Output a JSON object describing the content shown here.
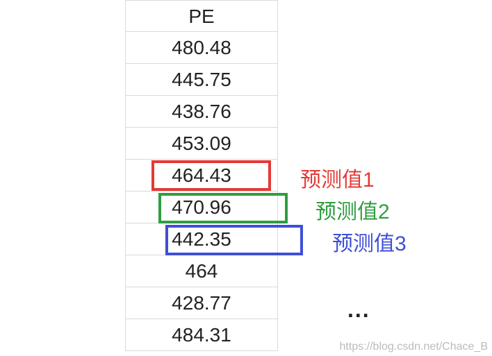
{
  "header": {
    "label": "PE"
  },
  "rows": [
    {
      "value": "480.48"
    },
    {
      "value": "445.75"
    },
    {
      "value": "438.76"
    },
    {
      "value": "453.09"
    },
    {
      "value": "464.43"
    },
    {
      "value": "470.96"
    },
    {
      "value": "442.35"
    },
    {
      "value": "464"
    },
    {
      "value": "428.77"
    },
    {
      "value": "484.31"
    }
  ],
  "annotations": [
    {
      "label": "预测值1",
      "color": "red"
    },
    {
      "label": "预测值2",
      "color": "green"
    },
    {
      "label": "预测值3",
      "color": "blue"
    }
  ],
  "ellipsis": "...",
  "watermark": "https://blog.csdn.net/Chace_B"
}
